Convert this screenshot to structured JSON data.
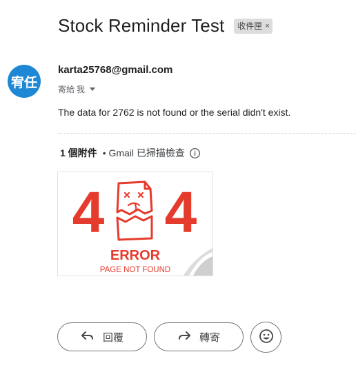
{
  "email": {
    "subject": "Stock Reminder Test",
    "label": "收件匣",
    "label_remove": "×",
    "avatar_text": "宥任",
    "sender": "karta25768@gmail.com",
    "recipient_prefix": "寄給",
    "recipient": "我",
    "body": "The data for 2762 is not found or the serial didn't exist."
  },
  "attachments": {
    "count_label": "1 個附件",
    "scan_label": "• Gmail 已掃描檢查",
    "items": [
      {
        "error_code_left": "4",
        "error_code_right": "4",
        "title": "ERROR",
        "subtitle": "PAGE NOT FOUND"
      }
    ]
  },
  "actions": {
    "reply": "回覆",
    "forward": "轉寄"
  },
  "colors": {
    "avatar_bg": "#1e88d4",
    "error_red": "#e53b2c"
  },
  "icons": {
    "info": "info-icon",
    "reply": "reply-arrow-icon",
    "forward": "forward-arrow-icon",
    "emoji": "smiley-icon"
  }
}
